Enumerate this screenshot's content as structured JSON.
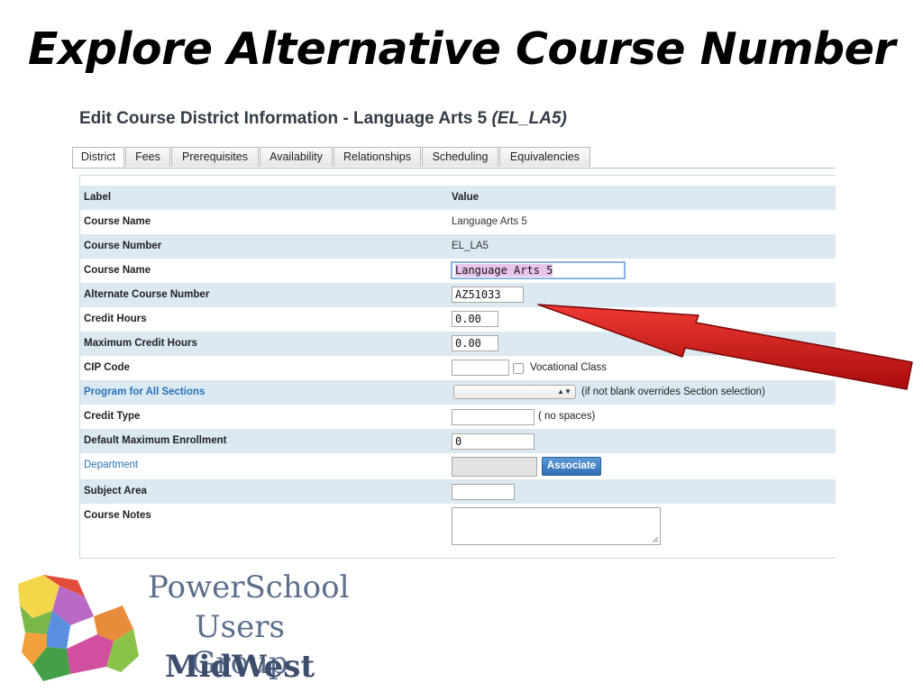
{
  "slide": {
    "title": "Explore Alternative Course Number"
  },
  "page": {
    "heading_main": "Edit Course District Information - Language Arts 5 ",
    "heading_code": "(EL_LA5)"
  },
  "tabs": [
    {
      "label": "District",
      "active": true
    },
    {
      "label": "Fees"
    },
    {
      "label": "Prerequisites"
    },
    {
      "label": "Availability"
    },
    {
      "label": "Relationships"
    },
    {
      "label": "Scheduling"
    },
    {
      "label": "Equivalencies"
    }
  ],
  "table": {
    "header_label": "Label",
    "header_value": "Value",
    "rows": [
      {
        "label": "Course Name",
        "value": "Language Arts 5"
      },
      {
        "label": "Course Number",
        "value": "EL_LA5"
      },
      {
        "label": "Course Name",
        "input": "Language Arts 5"
      },
      {
        "label": "Alternate Course Number",
        "input": "AZ51033"
      },
      {
        "label": "Credit Hours",
        "input": "0.00"
      },
      {
        "label": "Maximum Credit Hours",
        "input": "0.00"
      },
      {
        "label": "CIP Code",
        "input": "",
        "checkbox_label": "Vocational Class"
      },
      {
        "label": "Program for All Sections",
        "select": "",
        "note": "(if not blank overrides Section selection)"
      },
      {
        "label": "Credit Type",
        "input": "",
        "note": "( no spaces)"
      },
      {
        "label": "Default Maximum Enrollment",
        "input": "0"
      },
      {
        "label": "Department",
        "input": "",
        "button": "Associate"
      },
      {
        "label": "Subject Area",
        "input": ""
      },
      {
        "label": "Course Notes",
        "textarea": ""
      }
    ]
  },
  "logo": {
    "line1": "PowerSchool",
    "line2": "Users Group",
    "line3": "MidWest"
  },
  "colors": {
    "row_alt": "#dbe9f3",
    "link": "#2a72b5",
    "button": "#3c7fc4",
    "arrow": "#cc1111"
  }
}
